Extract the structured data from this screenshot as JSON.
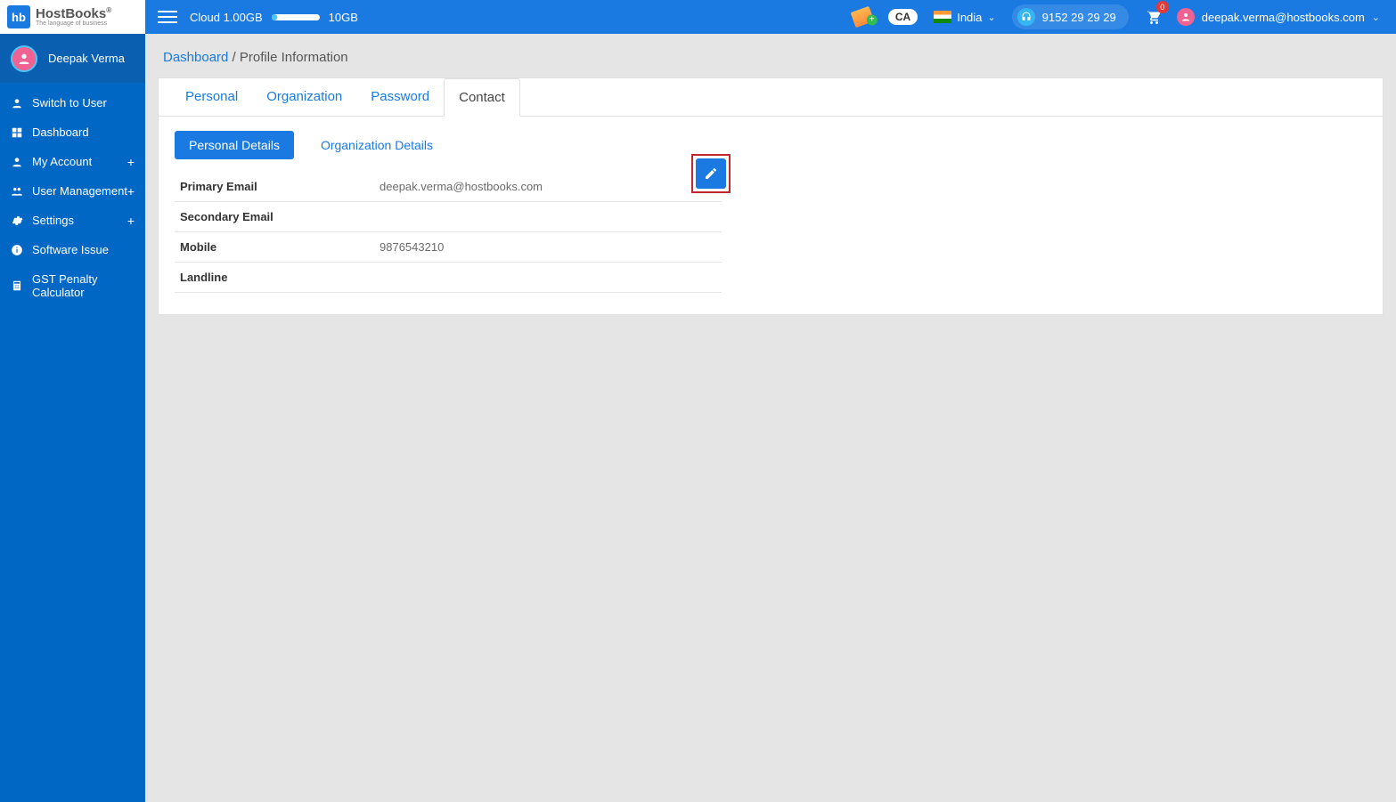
{
  "brand": {
    "mark": "hb",
    "name": "HostBooks",
    "tagline": "The language of business",
    "reg": "®"
  },
  "topbar": {
    "cloud_used": "Cloud 1.00GB",
    "cloud_total": "10GB",
    "ca_badge": "CA",
    "country": "India",
    "support_phone": "9152 29 29 29",
    "cart_count": "0",
    "user_email": "deepak.verma@hostbooks.com"
  },
  "sidebar": {
    "user_name": "Deepak Verma",
    "items": [
      {
        "label": "Switch to User",
        "icon": "user",
        "expandable": false
      },
      {
        "label": "Dashboard",
        "icon": "dashboard",
        "expandable": false
      },
      {
        "label": "My Account",
        "icon": "account",
        "expandable": true
      },
      {
        "label": "User Management",
        "icon": "users",
        "expandable": true
      },
      {
        "label": "Settings",
        "icon": "gear",
        "expandable": true
      },
      {
        "label": "Software Issue",
        "icon": "info",
        "expandable": false
      },
      {
        "label": "GST Penalty Calculator",
        "icon": "calc",
        "expandable": false
      }
    ]
  },
  "breadcrumb": {
    "root": "Dashboard",
    "sep": " / ",
    "current": "Profile Information"
  },
  "tabs": [
    "Personal",
    "Organization",
    "Password",
    "Contact"
  ],
  "active_tab": "Contact",
  "subtabs": [
    "Personal Details",
    "Organization Details"
  ],
  "active_subtab": "Personal Details",
  "contact": {
    "rows": [
      {
        "label": "Primary Email",
        "value": "deepak.verma@hostbooks.com"
      },
      {
        "label": "Secondary Email",
        "value": ""
      },
      {
        "label": "Mobile",
        "value": "9876543210"
      },
      {
        "label": "Landline",
        "value": ""
      }
    ]
  }
}
